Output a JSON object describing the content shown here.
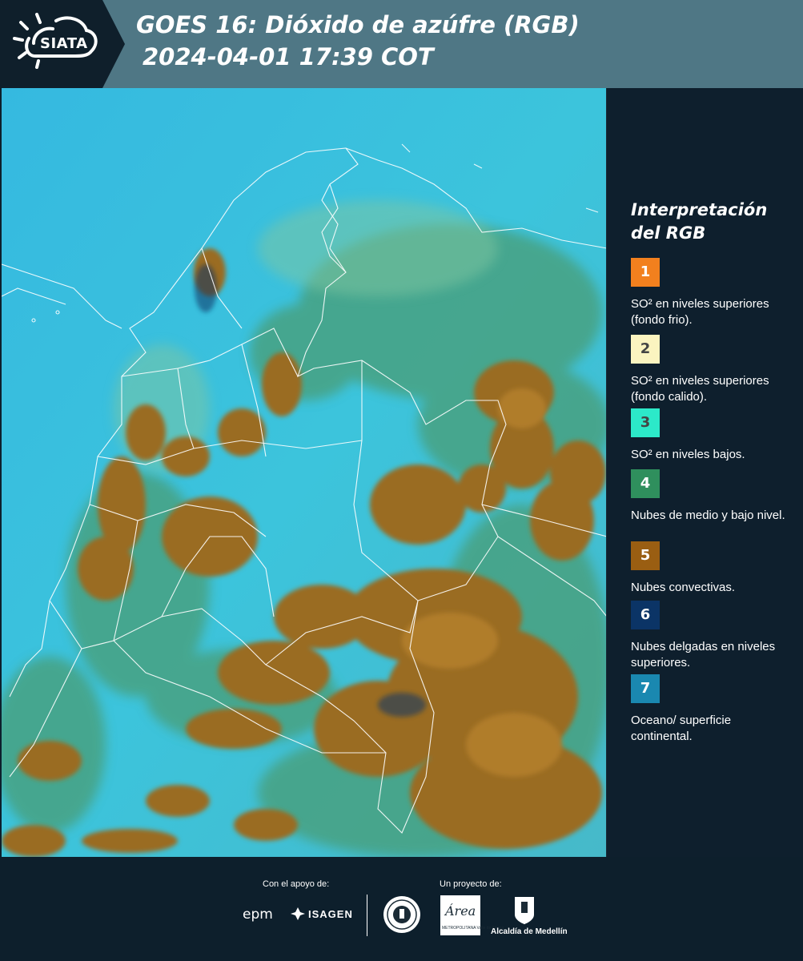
{
  "header": {
    "logo_text": "SIATA",
    "title_line1": "GOES 16: Dióxido de azúfre (RGB)",
    "title_line2": "2024-04-01 17:39 COT"
  },
  "legend": {
    "title": "Interpretación del RGB",
    "items": [
      {
        "number": "1",
        "color": "#f2801e",
        "label": "SO² en niveles superiores (fondo frio)."
      },
      {
        "number": "2",
        "color": "#fbf4c0",
        "label": "SO² en niveles superiores (fondo calido)."
      },
      {
        "number": "3",
        "color": "#2ce9c9",
        "label": "SO² en niveles bajos."
      },
      {
        "number": "4",
        "color": "#2f8f5d",
        "label": "Nubes de medio y bajo nivel."
      },
      {
        "number": "5",
        "color": "#9a5e12",
        "label": "Nubes convectivas."
      },
      {
        "number": "6",
        "color": "#0b3466",
        "label": "Nubes delgadas en niveles superiores."
      },
      {
        "number": "7",
        "color": "#1a88b0",
        "label": "Oceano/ superficie continental."
      }
    ]
  },
  "footer": {
    "support_label": "Con el apoyo de:",
    "project_label": "Un proyecto de:",
    "sponsor1": "epm",
    "sponsor2": "ISAGEN",
    "partner1": "Área",
    "partner1_sub": "METROPOLITANA Valle de Aburrá",
    "partner2": "Alcaldía de Medellín"
  },
  "colors": {
    "header_bg": "#4f7785",
    "panel_bg": "#0e1f2d",
    "ocean_cyan": "#3dc0dd",
    "convective_brown": "#9a6c22",
    "mid_level_green": "#3e8f63"
  }
}
